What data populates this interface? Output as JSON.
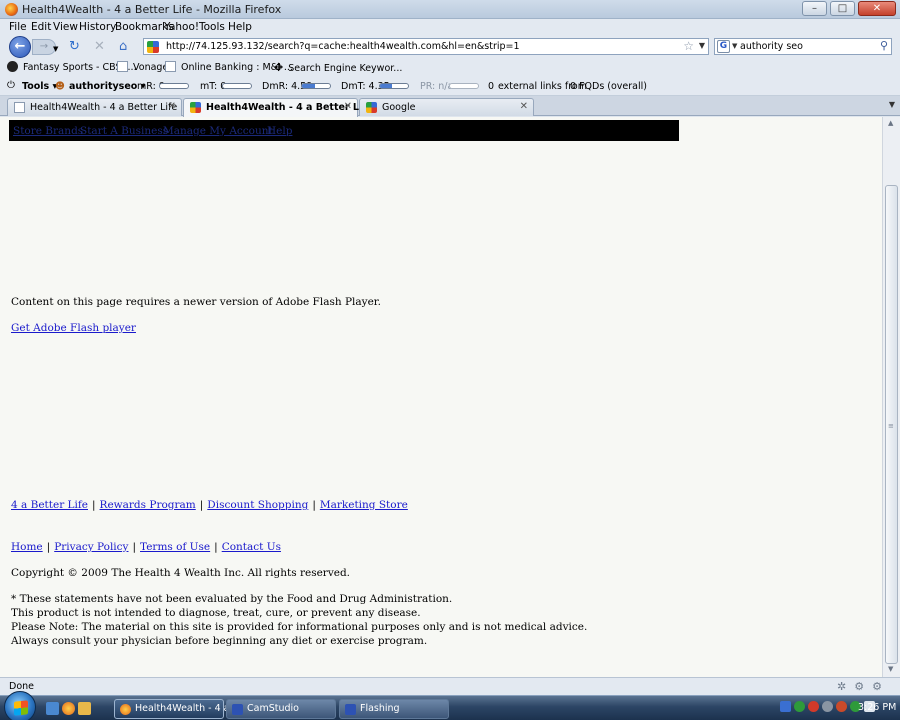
{
  "window": {
    "title": "Health4Wealth - 4 a Better Life - Mozilla Firefox",
    "controls": [
      "–",
      "□",
      "✕"
    ]
  },
  "menu": [
    "File",
    "Edit",
    "View",
    "History",
    "Bookmarks",
    "Yahoo!",
    "Tools",
    "Help"
  ],
  "nav": {
    "url": "http://74.125.93.132/search?q=cache:health4wealth.com&hl=en&strip=1",
    "search_value": "authority seo",
    "search_engine": "G"
  },
  "bookmarks": [
    "Fantasy Sports - CBSS...",
    "Vonage",
    "Online Banking : M&I ...",
    "Search Engine Keywor..."
  ],
  "seo_toolbar": {
    "tools": "Tools",
    "profile": "authorityseo",
    "mr": "mR: 0",
    "mr_level": 0,
    "mt": "mT: 0",
    "mt_level": 0,
    "dmr": "DmR: 4.59",
    "dmr_level": 0.46,
    "dmt": "DmT: 4.35",
    "dmt_level": 0.43,
    "pr": "PR: n/a",
    "pr_level": 0,
    "external_count": "0",
    "external_text": "external links from",
    "fqds_text": "0 FQDs (overall)"
  },
  "tabs": [
    {
      "label": "Health4Wealth - 4 a Better Life",
      "active": false
    },
    {
      "label": "Health4Wealth - 4 a Better Life",
      "active": true
    },
    {
      "label": "Google",
      "active": false
    }
  ],
  "page": {
    "top_nav": [
      "Store Brands",
      "Start A Business",
      "Manage My Account",
      "Help"
    ],
    "flash_notice": "Content on this page requires a newer version of Adobe Flash Player.",
    "flash_link": "Get Adobe Flash player",
    "footer_links_1": [
      "4 a Better Life",
      "Rewards Program",
      "Discount Shopping",
      "Marketing Store"
    ],
    "footer_links_2": [
      "Home",
      "Privacy Policy",
      "Terms of Use",
      "Contact Us"
    ],
    "separator": "|",
    "copyright": "Copyright © 2009 The Health 4 Wealth Inc. All rights reserved.",
    "disclaimer": [
      "* These statements have not been evaluated by the Food and Drug Administration.",
      "This product is not intended to diagnose, treat, cure, or prevent any disease.",
      "Please Note: The material on this site is provided for informational purposes only and is not medical advice.",
      "Always consult your physician before beginning any diet or exercise program."
    ]
  },
  "status": {
    "text": "Done"
  },
  "taskbar": {
    "buttons": [
      "Health4Wealth - 4 a ...",
      "CamStudio",
      "Flashing"
    ],
    "clock": "3:26 PM"
  }
}
